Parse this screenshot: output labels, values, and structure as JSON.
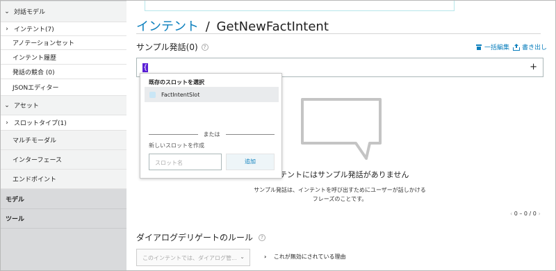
{
  "sidebar": {
    "items": [
      {
        "label": "対話モデル",
        "chevron": "⌄"
      },
      {
        "label": "インテント(7)",
        "chevron": "›"
      },
      {
        "label": "アノテーションセット"
      },
      {
        "label": "インテント履歴"
      },
      {
        "label": "発話の競合 (0)"
      },
      {
        "label": "JSONエディター"
      },
      {
        "label": "アセット",
        "chevron": "⌄"
      },
      {
        "label": "スロットタイプ(1)",
        "chevron": "›"
      },
      {
        "label": "マルチモーダル"
      },
      {
        "label": "インターフェース"
      },
      {
        "label": "エンドポイント"
      },
      {
        "label": "モデル"
      },
      {
        "label": "ツール"
      }
    ]
  },
  "header": {
    "link": "インテント",
    "separator": "/",
    "intent_name": "GetNewFactIntent"
  },
  "utterances": {
    "label": "サンプル発話(0)",
    "bulk_edit": "一括編集",
    "export": "書き出し",
    "input_value": "{",
    "add_symbol": "+",
    "empty_title": "インテントにはサンプル発話がありません",
    "empty_desc": "サンプル発話は、インテントを呼び出すためにユーザーが話しかけるフレーズのことです。",
    "pager": "0 – 0 / 0"
  },
  "slot_popup": {
    "heading": "既存のスロットを選択",
    "option": "FactIntentSlot",
    "or_text": "または",
    "new_label": "新しいスロットを作成",
    "input_placeholder": "スロット名",
    "add_button": "追加"
  },
  "dialog": {
    "label": "ダイアログデリゲートのルール",
    "select_value": "このインテントでは、ダイアログ管...",
    "reason": "これが無効にされている理由"
  },
  "colors": {
    "link": "#0b7fbd",
    "sidebar_bg": "#d9dadc",
    "cursor_highlight": "#5a1fd6"
  }
}
